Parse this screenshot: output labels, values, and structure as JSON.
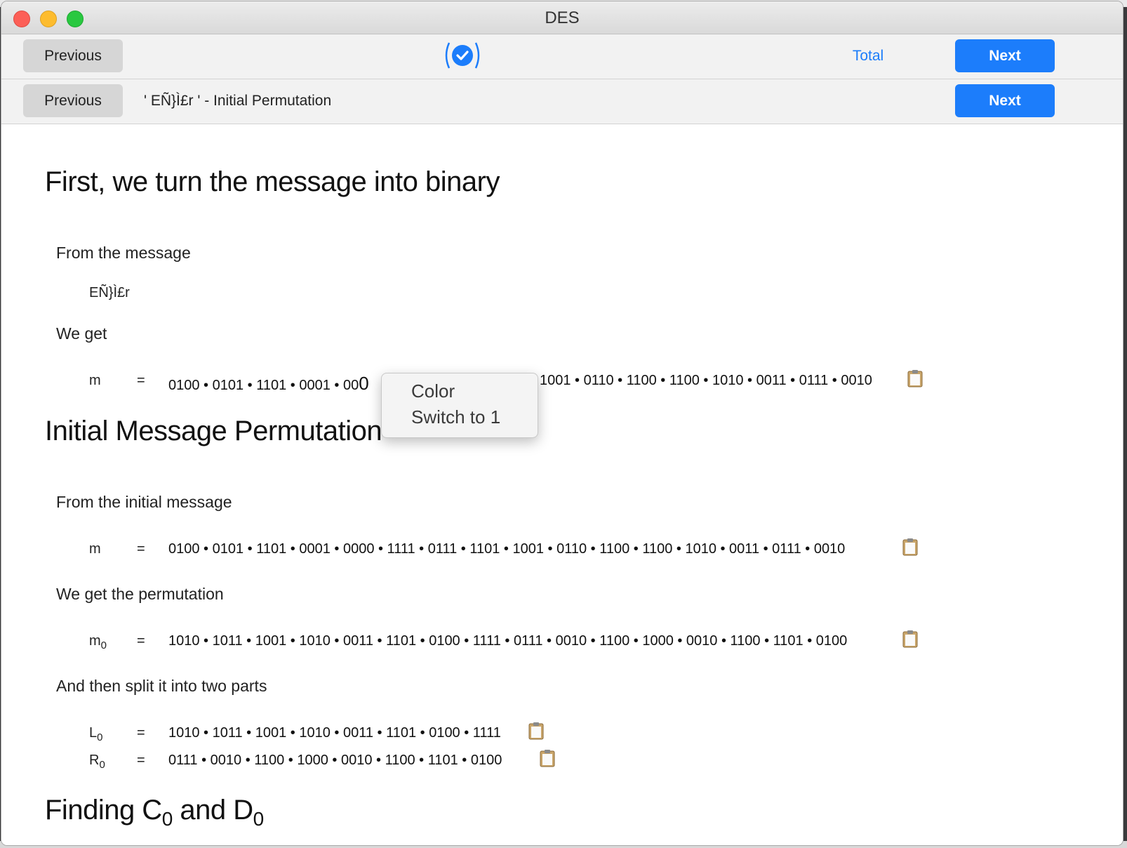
{
  "window": {
    "title": "DES"
  },
  "toolbar_top": {
    "previous_label": "Previous",
    "total_label": "Total",
    "next_label": "Next"
  },
  "toolbar_step": {
    "previous_label": "Previous",
    "step_title": "' EÑ}Ì£r ' - Initial Permutation",
    "next_label": "Next"
  },
  "section1": {
    "heading": "First, we turn the message into binary",
    "from_label": "From the message",
    "message": "EÑ}Ì£r",
    "we_get_label": "We get",
    "m_var": "m",
    "eq": "=",
    "m_bits_left": "0100 • 0101 • 1101 • 0001 • 00",
    "m_bits_cut": "0",
    "m_bits_right": "1001 • 0110 • 1100 • 1100 • 1010 • 0011 • 0111 • 0010"
  },
  "context_menu": {
    "items": [
      "Color",
      "Switch to 1"
    ]
  },
  "section2": {
    "heading": "Initial Message Permutation",
    "from_label": "From the initial message",
    "m_var": "m",
    "m_bits": "0100 • 0101 • 1101 • 0001 • 0000 • 1111 • 0111 • 1101 • 1001 • 0110 • 1100 • 1100 • 1010 • 0011 • 0111 • 0010",
    "perm_label": "We get the permutation",
    "m0_var": "m",
    "m0_sub": "0",
    "m0_bits": "1010 • 1011 • 1001 • 1010 • 0011 • 1101 • 0100 • 1111 • 0111 • 0010 • 1100 • 1000 • 0010 • 1100 • 1101 • 0100",
    "split_label": "And then split it into two parts",
    "l0_var": "L",
    "l0_sub": "0",
    "l0_bits": "1010 • 1011 • 1001 • 1010 • 0011 • 1101 • 0100 • 1111",
    "r0_var": "R",
    "r0_sub": "0",
    "r0_bits": "0111 • 0010 • 1100 • 1000 • 0010 • 1100 • 1101 • 0100",
    "eq": "="
  },
  "section3": {
    "heading_a": "Finding C",
    "heading_sub1": "0",
    "heading_b": " and D",
    "heading_sub2": "0"
  },
  "colors": {
    "accent": "#1c7dfb",
    "button_gray": "#d6d6d6"
  }
}
